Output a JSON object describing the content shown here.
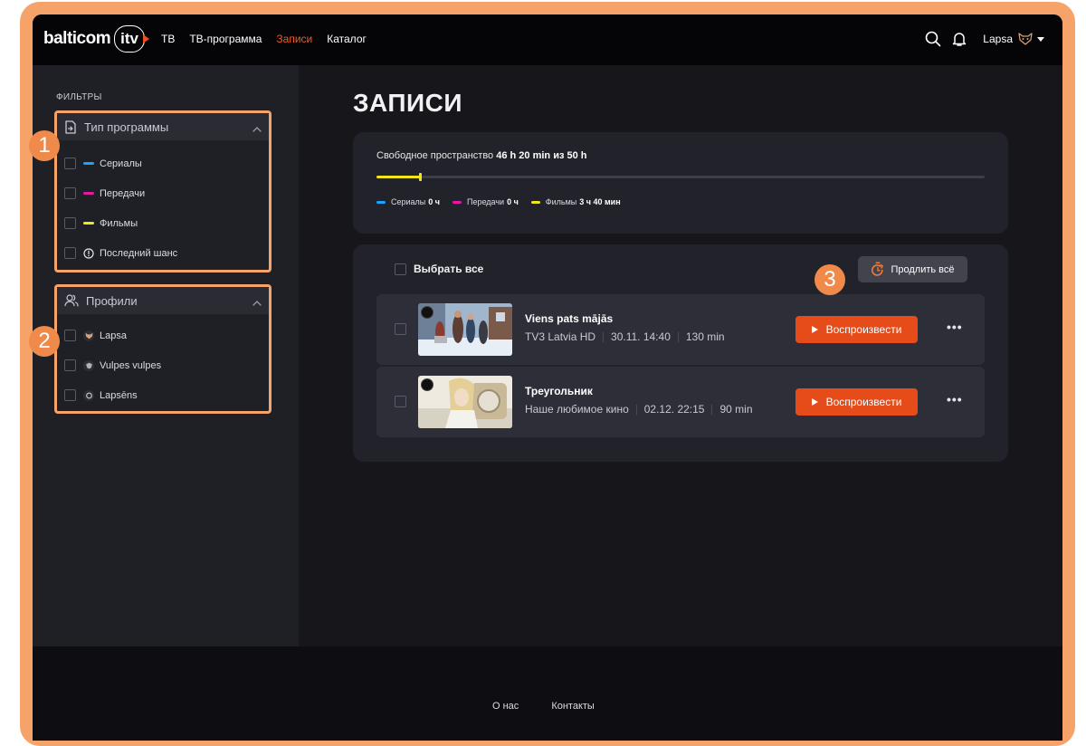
{
  "brand": {
    "name": "balticom",
    "suffix": "itv"
  },
  "nav": [
    {
      "label": "ТВ",
      "active": false
    },
    {
      "label": "ТВ-программа",
      "active": false
    },
    {
      "label": "Записи",
      "active": true
    },
    {
      "label": "Каталог",
      "active": false
    }
  ],
  "user": {
    "name": "Lapsa"
  },
  "sidebar": {
    "filters_label": "ФИЛЬТРЫ",
    "program_type": {
      "title": "Тип программы",
      "options": [
        {
          "label": "Сериалы",
          "color": "#1aa3ff"
        },
        {
          "label": "Передачи",
          "color": "#e01aa3"
        },
        {
          "label": "Фильмы",
          "color": "#f2e619"
        },
        {
          "label": "Последний шанс",
          "icon": "info-circle-icon"
        }
      ]
    },
    "profiles": {
      "title": "Профили",
      "options": [
        {
          "label": "Lapsa"
        },
        {
          "label": "Vulpes vulpes"
        },
        {
          "label": "Lapsēns"
        }
      ]
    }
  },
  "main": {
    "title": "ЗАПИСИ",
    "storage": {
      "label": "Свободное пространство",
      "value": "46 h 20 min из 50 h",
      "used_fraction": 0.073,
      "legend": [
        {
          "label": "Сериалы",
          "value": "0 ч",
          "color": "#1aa3ff"
        },
        {
          "label": "Передачи",
          "value": "0 ч",
          "color": "#e01aa3"
        },
        {
          "label": "Фильмы",
          "value": "3 ч 40 мин",
          "color": "#f2e619"
        }
      ]
    },
    "select_all": "Выбрать все",
    "extend_all": "Продлить всё",
    "recordings": [
      {
        "title": "Viens pats mājās",
        "channel": "TV3 Latvia HD",
        "datetime": "30.11. 14:40",
        "duration": "130 min",
        "play": "Воспроизвести"
      },
      {
        "title": "Треугольник",
        "channel": "Наше любимое кино",
        "datetime": "02.12. 22:15",
        "duration": "90 min",
        "play": "Воспроизвести"
      }
    ]
  },
  "annotations": [
    "1",
    "2",
    "3"
  ],
  "footer": {
    "about": "О нас",
    "contacts": "Контакты"
  },
  "colors": {
    "accent": "#f25a23",
    "play_button": "#e54c1a",
    "callout": "#f6a36a"
  }
}
